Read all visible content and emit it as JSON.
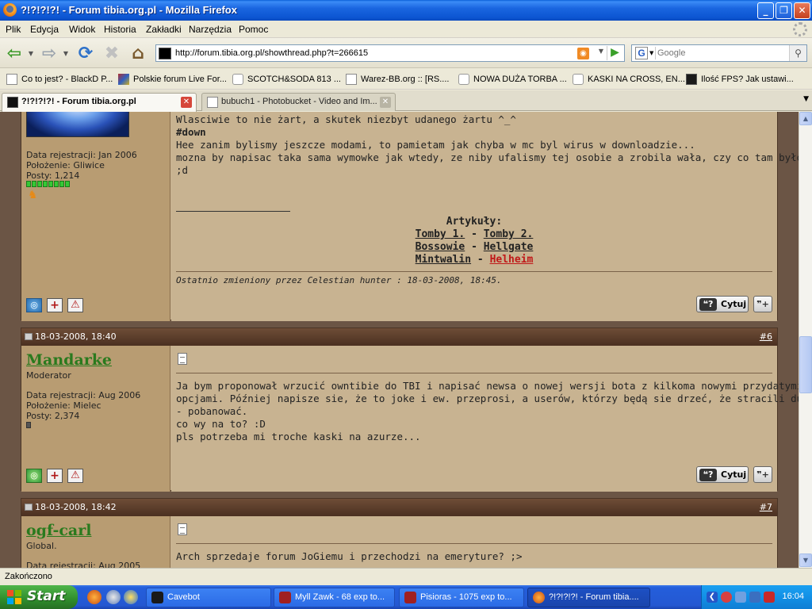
{
  "window": {
    "title": "?!?!?!?! - Forum tibia.org.pl - Mozilla Firefox",
    "minimize": "_",
    "restore": "❐",
    "close": "✕"
  },
  "menu": [
    "Plik",
    "Edycja",
    "Widok",
    "Historia",
    "Zakładki",
    "Narzędzia",
    "Pomoc"
  ],
  "nav": {
    "url": "http://forum.tibia.org.pl/showthread.php?t=266615",
    "search_placeholder": "Google",
    "search_engine": "G"
  },
  "bookmarks": [
    "Co to jest? - BlackD P...",
    "Polskie forum Live For...",
    "SCOTCH&SODA 813 ...",
    "Warez-BB.org :: [RS....",
    "NOWA DUŻA TORBA ...",
    "KASKI NA CROSS, EN...",
    "Ilość FPS? Jak ustawi..."
  ],
  "tabs": [
    {
      "label": "?!?!?!?! - Forum tibia.org.pl",
      "active": true
    },
    {
      "label": "bubuch1 - Photobucket - Video and Im...",
      "active": false
    }
  ],
  "post5": {
    "user_info": [
      "Data rejestracji: Jan 2006",
      "Położenie: Gliwice",
      "Posty: 1,214"
    ],
    "rep_blocks": 8,
    "lines": [
      "Wlasciwie to nie żart, a skutek niezbyt udanego żartu ^_^",
      "",
      "#down",
      "",
      "Hee zanim bylismy jeszcze modami, to pamietam jak chyba w mc byl wirus w downloadzie...",
      "mozna by napisac taka sama wymowke jak wtedy, ze niby ufalismy tej osobie a zrobila wała, czy co tam było...",
      ";d"
    ],
    "articles_title": "Artykuły:",
    "articles": [
      "Tomby 1.",
      "Tomby 2.",
      "Bossowie",
      "Hellgate",
      "Mintwalin",
      "Helheim"
    ],
    "separator": "-",
    "edited": "Ostatnio zmieniony przez Celestian hunter : 18-03-2008, 18:45.",
    "quote": "Cytuj"
  },
  "post6": {
    "date": "18-03-2008, 18:40",
    "number": "#6",
    "username": "Mandarke",
    "title": "Moderator",
    "user_info": [
      "Data rejestracji: Aug 2006",
      "Położenie: Mielec",
      "Posty: 2,374"
    ],
    "rep_blocks": 1,
    "lines": [
      "Ja bym proponował wrzucić owntibie do TBI i napisać newsa o nowej wersji bota z kilkoma nowymi przydatymi",
      "opcjami. Później napisze sie, że to joke i ew. przeprosi, a userów, którzy będą sie drzeć, że stracili dużo itansów",
      "- pobanować.",
      "",
      "co wy na to? :D",
      "pls potrzeba mi troche kaski na azurze..."
    ],
    "quote": "Cytuj"
  },
  "post7": {
    "date": "18-03-2008, 18:42",
    "number": "#7",
    "username": "ogf-carl",
    "title": "Global.",
    "user_info": [
      "Data rejestracji: Aug 2005"
    ],
    "lines": [
      "Arch sprzedaje forum JoGiemu i przechodzi na emeryture? ;>"
    ]
  },
  "status": "Zakończono",
  "taskbar": {
    "start": "Start",
    "tasks": [
      "Cavebot",
      "Myll Zawk - 68 exp to...",
      "Pisioras - 1075 exp to...",
      "?!?!?!?! - Forum tibia...."
    ],
    "clock": "16:04"
  },
  "colors": {
    "forum_bg": "#c8b391",
    "user_panel": "#b89c72",
    "post_header": "#5a3c29",
    "username_green": "#2a7a1e",
    "link_red": "#c01818"
  }
}
